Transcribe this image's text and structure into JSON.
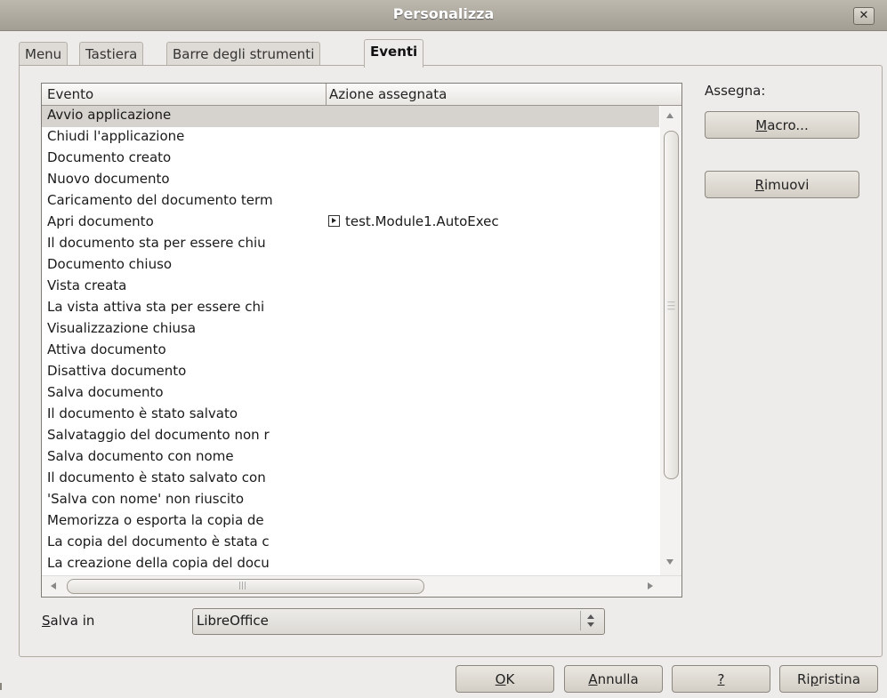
{
  "window": {
    "title": "Personalizza",
    "close_label": "✕"
  },
  "tabs": [
    {
      "label": "Menu",
      "active": false
    },
    {
      "label": "Tastiera",
      "active": false
    },
    {
      "label": "Barre degli strumenti",
      "active": false
    },
    {
      "label": "Eventi",
      "active": true
    }
  ],
  "events_table": {
    "columns": [
      "Evento",
      "Azione assegnata"
    ],
    "selected_index": 0,
    "rows": [
      {
        "event": "Avvio applicazione",
        "action": ""
      },
      {
        "event": "Chiudi l'applicazione",
        "action": ""
      },
      {
        "event": "Documento creato",
        "action": ""
      },
      {
        "event": "Nuovo documento",
        "action": ""
      },
      {
        "event": "Caricamento del documento term",
        "action": ""
      },
      {
        "event": "Apri documento",
        "action": "test.Module1.AutoExec"
      },
      {
        "event": "Il documento sta per essere chiu",
        "action": ""
      },
      {
        "event": "Documento chiuso",
        "action": ""
      },
      {
        "event": "Vista creata",
        "action": ""
      },
      {
        "event": "La vista attiva sta per essere chi",
        "action": ""
      },
      {
        "event": "Visualizzazione chiusa",
        "action": ""
      },
      {
        "event": "Attiva documento",
        "action": ""
      },
      {
        "event": "Disattiva documento",
        "action": ""
      },
      {
        "event": "Salva documento",
        "action": ""
      },
      {
        "event": "Il documento è stato salvato",
        "action": ""
      },
      {
        "event": "Salvataggio del documento non r",
        "action": ""
      },
      {
        "event": "Salva documento con nome",
        "action": ""
      },
      {
        "event": "Il documento è stato salvato con",
        "action": ""
      },
      {
        "event": "'Salva con nome' non riuscito",
        "action": ""
      },
      {
        "event": "Memorizza o esporta la copia de",
        "action": ""
      },
      {
        "event": "La copia del documento è stata c",
        "action": ""
      },
      {
        "event": "La creazione della copia del docu",
        "action": ""
      }
    ]
  },
  "assign": {
    "label": "Assegna:",
    "macro_button": {
      "mnemonic": "M",
      "rest": "acro..."
    },
    "remove_button": {
      "mnemonic": "R",
      "rest": "imuovi"
    }
  },
  "save_in": {
    "label_mnemonic": "S",
    "label_rest": "alva in",
    "value": "LibreOffice"
  },
  "footer": {
    "ok": {
      "mnemonic": "O",
      "rest": "K"
    },
    "cancel": {
      "mnemonic": "A",
      "rest": "nnulla"
    },
    "help": {
      "mnemonic": "?",
      "rest": ""
    },
    "reset": {
      "pre": "Ri",
      "mnemonic": "p",
      "rest": "ristina"
    }
  },
  "colors": {
    "selected_row": "#d6d3ce",
    "titlebar": "#a39e94"
  }
}
